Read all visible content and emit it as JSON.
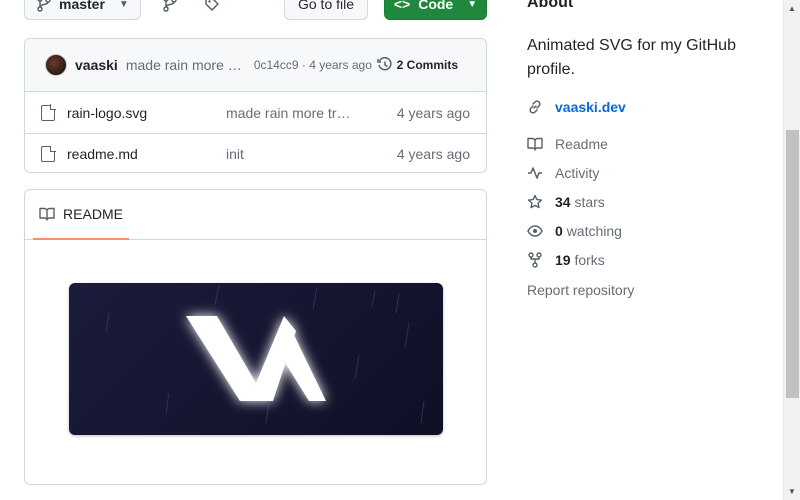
{
  "toolbar": {
    "branch_label": "master",
    "go_to_file_label": "Go to file",
    "code_label": "Code"
  },
  "commit": {
    "author": "vaaski",
    "message": "made rain more transparent",
    "hash_time": "0c14cc9 · 4 years ago",
    "commits_label": "2 Commits"
  },
  "files": [
    {
      "name": "rain-logo.svg",
      "message": "made rain more transparent",
      "date": "4 years ago"
    },
    {
      "name": "readme.md",
      "message": "init",
      "date": "4 years ago"
    }
  ],
  "readme": {
    "tab_label": "README"
  },
  "about": {
    "title": "About",
    "description": "Animated SVG for my GitHub profile.",
    "website": "vaaski.dev",
    "readme_label": "Readme",
    "activity_label": "Activity",
    "stars_count": "34",
    "stars_label": "stars",
    "watching_count": "0",
    "watching_label": "watching",
    "forks_count": "19",
    "forks_label": "forks",
    "report_label": "Report repository"
  },
  "icons": {
    "branch": "git-branch-icon",
    "tag": "tag-icon",
    "code": "code-icon",
    "history": "history-icon",
    "file": "file-icon",
    "book": "book-icon",
    "link": "link-icon",
    "pulse": "pulse-icon",
    "star": "star-icon",
    "eye": "eye-icon",
    "fork": "repo-forked-icon"
  },
  "colors": {
    "accent_green": "#1f883d",
    "link_blue": "#0969da",
    "tab_underline": "#fd8c73",
    "banner_bg": "#14152f"
  }
}
